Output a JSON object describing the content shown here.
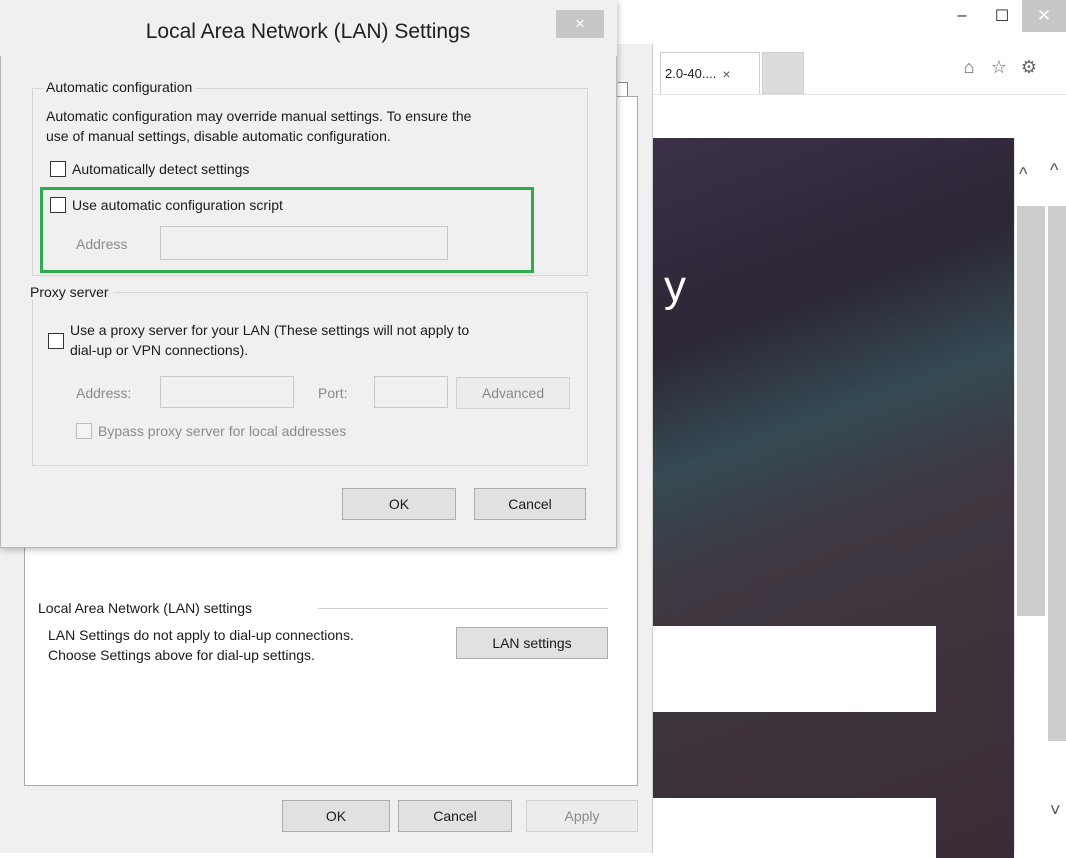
{
  "browser": {
    "window_buttons": {
      "minimize": "–",
      "maximize": "☐",
      "close": "✕"
    },
    "tab": {
      "label": "2.0-40....",
      "close": "×"
    },
    "scroll_arrows": {
      "up": "^",
      "down": "˅"
    },
    "toolbar_icons": {
      "home": "⌂",
      "favorites": "☆",
      "settings": "⚙"
    },
    "page_text": "y"
  },
  "internet_options": {
    "lan_group_title": "Local Area Network (LAN) settings",
    "lan_desc_line1": "LAN Settings do not apply to dial-up connections.",
    "lan_desc_line2": "Choose Settings above for dial-up settings.",
    "lan_settings_button": "LAN settings",
    "ok_button": "OK",
    "cancel_button": "Cancel",
    "apply_button": "Apply"
  },
  "lan_dialog": {
    "title": "Local Area Network (LAN) Settings",
    "close": "×",
    "auto_config": {
      "title": "Automatic configuration",
      "desc_line1": "Automatic configuration may override manual settings.  To ensure the",
      "desc_line2": "use of manual settings, disable automatic configuration.",
      "auto_detect_label": "Automatically detect settings",
      "auto_detect_checked": false,
      "use_script_label": "Use automatic configuration script",
      "use_script_checked": false,
      "address_label": "Address",
      "address_value": ""
    },
    "proxy": {
      "title": "Proxy server",
      "use_proxy_line1": "Use a proxy server for your LAN (These settings will not apply to",
      "use_proxy_line2": "dial-up or VPN connections).",
      "use_proxy_checked": false,
      "address_label": "Address:",
      "address_value": "",
      "port_label": "Port:",
      "port_value": "",
      "advanced_button": "Advanced",
      "bypass_label": "Bypass proxy server for local addresses",
      "bypass_checked": false
    },
    "ok_button": "OK",
    "cancel_button": "Cancel"
  },
  "colors": {
    "highlight_border": "#2eac4c",
    "dialog_bg": "#f0f0f0",
    "close_button_bg": "#c7c7c7"
  }
}
